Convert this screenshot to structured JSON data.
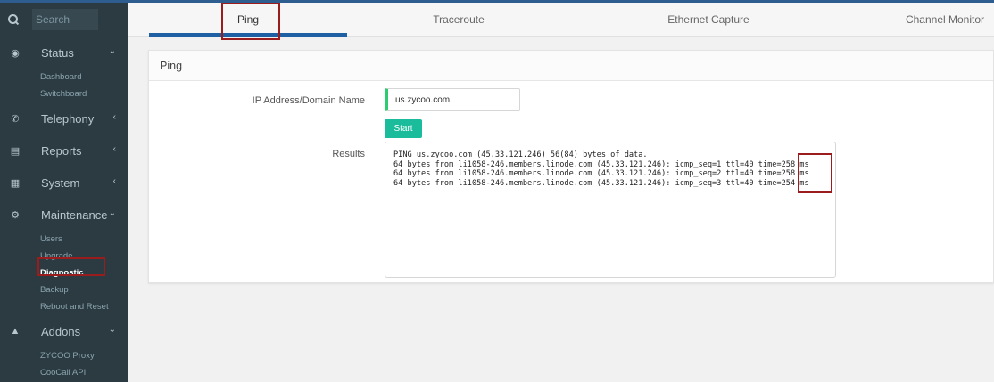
{
  "sidebar": {
    "search_placeholder": "Search",
    "items": [
      {
        "label": "Status",
        "icon": "dashboard-icon",
        "chevron": "v"
      },
      {
        "label": "Telephony",
        "icon": "phone-icon",
        "chevron": "<"
      },
      {
        "label": "Reports",
        "icon": "bar-chart-icon",
        "chevron": "<"
      },
      {
        "label": "System",
        "icon": "server-icon",
        "chevron": "<"
      },
      {
        "label": "Maintenance",
        "icon": "gear-icon",
        "chevron": "v"
      },
      {
        "label": "Addons",
        "icon": "sitemap-icon",
        "chevron": "v"
      }
    ],
    "status_sub": [
      "Dashboard",
      "Switchboard"
    ],
    "maintenance_sub": [
      "Users",
      "Upgrade",
      "Diagnostic",
      "Backup",
      "Reboot and Reset"
    ],
    "addons_sub": [
      "ZYCOO Proxy",
      "CooCall API"
    ],
    "active_sub": "Diagnostic"
  },
  "tabs": [
    "Ping",
    "Traceroute",
    "Ethernet Capture",
    "Channel Monitor"
  ],
  "active_tab": "Ping",
  "panel": {
    "title": "Ping",
    "ip_label": "IP Address/Domain Name",
    "ip_value": "us.zycoo.com",
    "start_label": "Start",
    "results_label": "Results",
    "results_lines": [
      "PING us.zycoo.com (45.33.121.246) 56(84) bytes of data.",
      "64 bytes from li1058-246.members.linode.com (45.33.121.246): icmp_seq=1 ttl=40 time=258 ms",
      "64 bytes from li1058-246.members.linode.com (45.33.121.246): icmp_seq=2 ttl=40 time=258 ms",
      "64 bytes from li1058-246.members.linode.com (45.33.121.246): icmp_seq=3 ttl=40 time=254 ms"
    ]
  },
  "colors": {
    "sidebar_bg": "#2c3b41",
    "accent_blue": "#1f5fa3",
    "start_button": "#1bbc9b",
    "input_accent": "#2ecc71",
    "highlight": "#9b1c1c"
  }
}
